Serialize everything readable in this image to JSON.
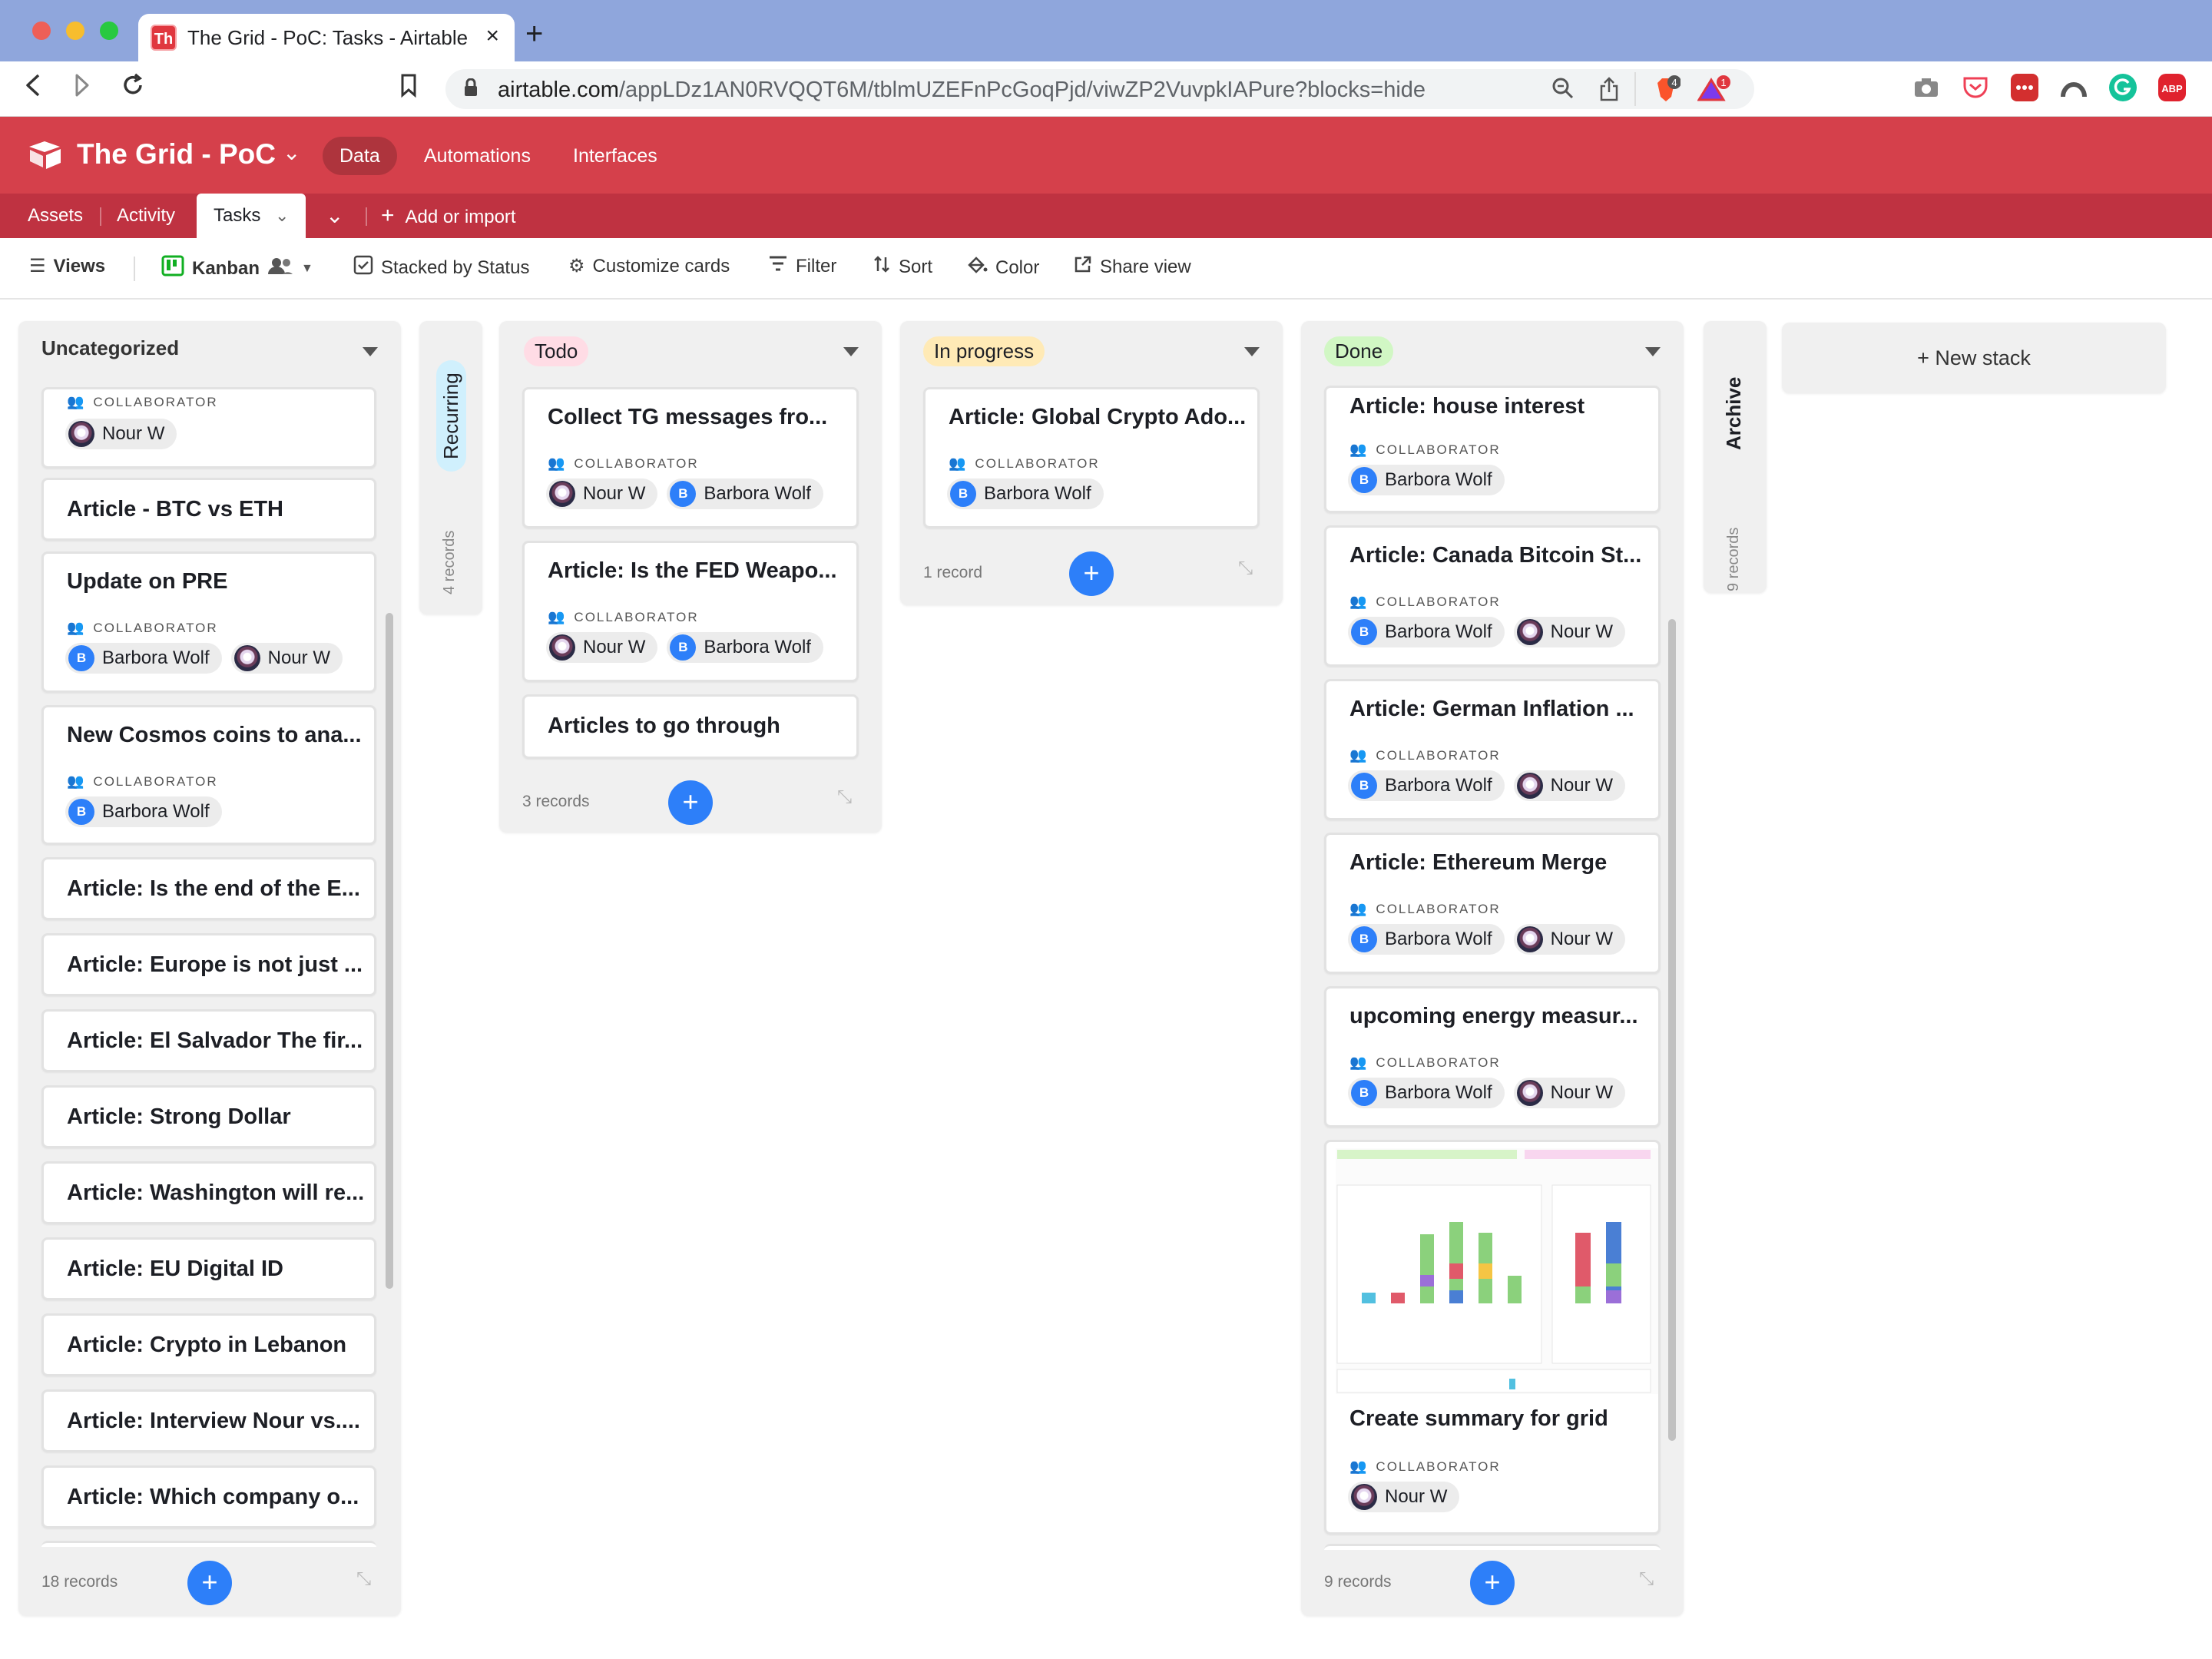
{
  "browser": {
    "tab_title": "The Grid - PoC: Tasks - Airtable",
    "tab_favicon": "Th",
    "url_host": "airtable.com",
    "url_path": "/appLDz1AN0RVQQT6M/tblmUZEFnPcGoqPjd/viwZP2VuvpkIAPure?blocks=hide",
    "brave_badge": "4",
    "alert_badge": "1"
  },
  "app": {
    "base_name": "The Grid - PoC",
    "top_tabs": [
      "Data",
      "Automations",
      "Interfaces"
    ],
    "tables": [
      "Assets",
      "Activity",
      "Tasks"
    ],
    "add_or_import": "Add or import"
  },
  "toolbar": {
    "views": "Views",
    "view_name": "Kanban",
    "stacked_by": "Stacked by Status",
    "customize": "Customize cards",
    "filter": "Filter",
    "sort": "Sort",
    "color": "Color",
    "share": "Share view"
  },
  "colors": {
    "header": "#d5404b",
    "table_bar": "#bf3241",
    "accent": "#2d7ff9",
    "todo_pill": "#ffdce5",
    "progress_pill": "#ffeab6",
    "done_pill": "#d1f7c4",
    "recurring_pill": "#d0f0fd"
  },
  "field_label": "COLLABORATOR",
  "stacks": {
    "uncategorized": {
      "name": "Uncategorized",
      "count": "18 records",
      "cards": [
        {
          "title": "",
          "collaborators": [
            "Nour W"
          ]
        },
        {
          "title": "Article - BTC vs ETH"
        },
        {
          "title": "Update on PRE",
          "collaborators": [
            "Barbora Wolf",
            "Nour W"
          ]
        },
        {
          "title": "New Cosmos coins to ana...",
          "collaborators": [
            "Barbora Wolf"
          ]
        },
        {
          "title": "Article: Is the end of the E..."
        },
        {
          "title": "Article: Europe is not just ..."
        },
        {
          "title": "Article: El Salvador The fir..."
        },
        {
          "title": "Article: Strong Dollar"
        },
        {
          "title": "Article: Washington will re..."
        },
        {
          "title": "Article: EU Digital ID"
        },
        {
          "title": "Article: Crypto in Lebanon"
        },
        {
          "title": "Article: Interview Nour vs...."
        },
        {
          "title": "Article: Which company o..."
        }
      ]
    },
    "recurring": {
      "name": "Recurring",
      "count": "4 records"
    },
    "todo": {
      "name": "Todo",
      "count": "3 records",
      "cards": [
        {
          "title": "Collect TG messages fro...",
          "collaborators": [
            "Nour W",
            "Barbora Wolf"
          ]
        },
        {
          "title": "Article: Is the FED Weapo...",
          "collaborators": [
            "Nour W",
            "Barbora Wolf"
          ]
        },
        {
          "title": "Articles to go through"
        }
      ]
    },
    "in_progress": {
      "name": "In progress",
      "count": "1 record",
      "cards": [
        {
          "title": "Article: Global Crypto Ado...",
          "collaborators": [
            "Barbora Wolf"
          ]
        }
      ]
    },
    "done": {
      "name": "Done",
      "count": "9 records",
      "cards": [
        {
          "title": "Article: house interest",
          "collaborators": [
            "Barbora Wolf"
          ]
        },
        {
          "title": "Article: Canada Bitcoin St...",
          "collaborators": [
            "Barbora Wolf",
            "Nour W"
          ]
        },
        {
          "title": "Article: German Inflation ...",
          "collaborators": [
            "Barbora Wolf",
            "Nour W"
          ]
        },
        {
          "title": "Article: Ethereum Merge",
          "collaborators": [
            "Barbora Wolf",
            "Nour W"
          ]
        },
        {
          "title": "upcoming energy measur...",
          "collaborators": [
            "Barbora Wolf",
            "Nour W"
          ]
        },
        {
          "title": "Create summary for grid",
          "collaborators": [
            "Nour W"
          ]
        }
      ]
    },
    "archive": {
      "name": "Archive",
      "count": "9 records"
    }
  },
  "new_stack": "+ New stack"
}
